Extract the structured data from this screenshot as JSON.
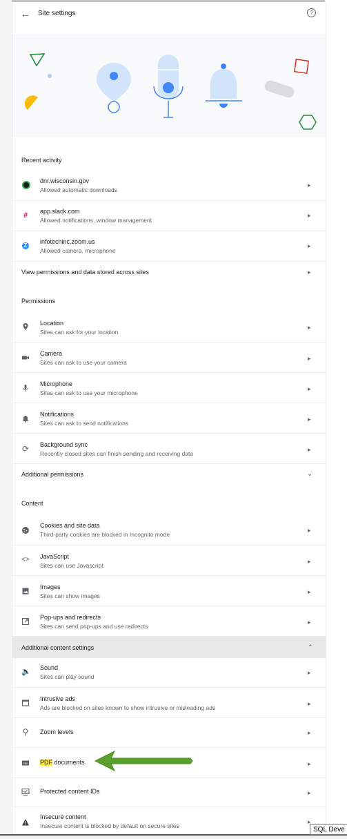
{
  "header": {
    "title": "Site settings"
  },
  "recent": {
    "title": "Recent activity",
    "items": [
      {
        "site": "dnr.wisconsin.gov",
        "desc": "Allowed automatic downloads"
      },
      {
        "site": "app.slack.com",
        "desc": "Allowed notifications, window management"
      },
      {
        "site": "infotechinc.zoom.us",
        "desc": "Allowed camera, microphone"
      }
    ],
    "view_all": "View permissions and data stored across sites"
  },
  "permissions": {
    "title": "Permissions",
    "items": [
      {
        "label": "Location",
        "desc": "Sites can ask for your location",
        "icon": "location-pin-icon"
      },
      {
        "label": "Camera",
        "desc": "Sites can ask to use your camera",
        "icon": "camera-icon"
      },
      {
        "label": "Microphone",
        "desc": "Sites can ask to use your microphone",
        "icon": "microphone-icon"
      },
      {
        "label": "Notifications",
        "desc": "Sites can ask to send notifications",
        "icon": "bell-icon"
      },
      {
        "label": "Background sync",
        "desc": "Recently closed sites can finish sending and receiving data",
        "icon": "sync-icon"
      }
    ],
    "additional": "Additional permissions"
  },
  "content": {
    "title": "Content",
    "items": [
      {
        "label": "Cookies and site data",
        "desc": "Third-party cookies are blocked in Incognito mode",
        "icon": "cookie-icon"
      },
      {
        "label": "JavaScript",
        "desc": "Sites can use Javascript",
        "icon": "code-icon"
      },
      {
        "label": "Images",
        "desc": "Sites can show images",
        "icon": "image-icon"
      },
      {
        "label": "Pop-ups and redirects",
        "desc": "Sites can send pop-ups and use redirects",
        "icon": "popup-icon"
      }
    ],
    "additional": "Additional content settings"
  },
  "additional_content": {
    "items": [
      {
        "label": "Sound",
        "desc": "Sites can play sound",
        "icon": "speaker-icon"
      },
      {
        "label": "Intrusive ads",
        "desc": "Ads are blocked on sites known to show intrusive or misleading ads",
        "icon": "ads-icon"
      }
    ],
    "zoom": "Zoom levels",
    "pdf_highlight": "PDF",
    "pdf_rest": " documents",
    "protected": "Protected content IDs",
    "insecure": {
      "label": "Insecure content",
      "desc": "Insecure content is blocked by default on secure sites"
    }
  },
  "tooltip": "SQL Deve",
  "colors": {
    "accent": "#4285f4",
    "arrow": "#5aa02c",
    "highlight": "#ffeb3b"
  }
}
